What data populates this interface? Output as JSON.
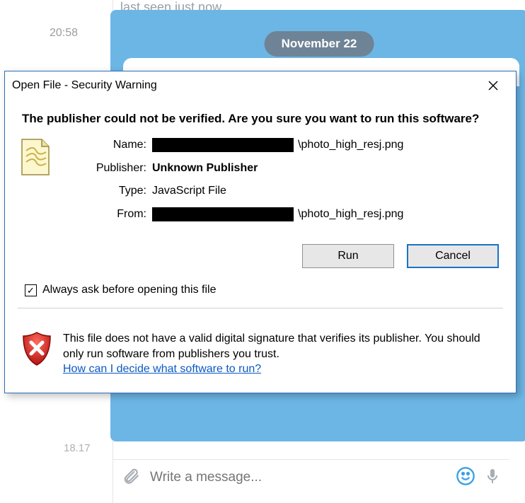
{
  "chat": {
    "top_cutoff_text": "last seen just now",
    "timestamp": "20:58",
    "date_pill": "November 22",
    "time2": "18.17",
    "input_placeholder": "Write a message..."
  },
  "dialog": {
    "title": "Open File - Security Warning",
    "heading": "The publisher could not be verified.  Are you sure you want to run this software?",
    "labels": {
      "name": "Name:",
      "publisher": "Publisher:",
      "type": "Type:",
      "from": "From:"
    },
    "values": {
      "name_suffix": "\\photo_high_resj.png",
      "publisher": "Unknown Publisher",
      "type": "JavaScript File",
      "from_suffix": "\\photo_high_resj.png"
    },
    "buttons": {
      "run": "Run",
      "cancel": "Cancel"
    },
    "checkbox_label": "Always ask before opening this file",
    "checkbox_checked": "✓",
    "footer": {
      "text": "This file does not have a valid digital signature that verifies its publisher.  You should only run software from publishers you trust.",
      "link": "How can I decide what software to run?"
    }
  }
}
